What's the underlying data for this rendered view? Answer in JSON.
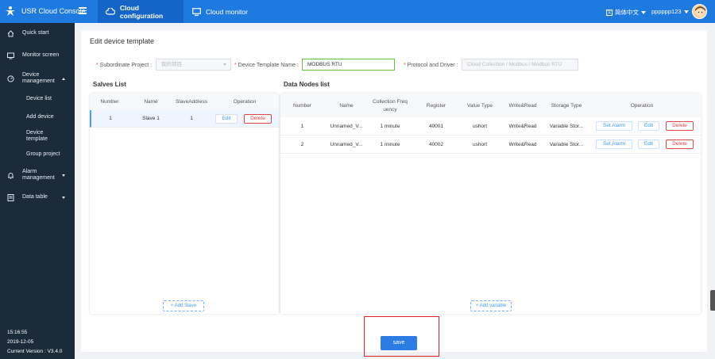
{
  "topbar": {
    "brand": "USR Cloud Console",
    "tabs": [
      {
        "label": "Cloud configuration",
        "active": true
      },
      {
        "label": "Cloud monitor",
        "active": false
      }
    ],
    "language": "简体中文",
    "username": "pppppp123",
    "colors": {
      "bar": "#1f7ae0",
      "active_tab": "#1565c8"
    }
  },
  "sidebar": {
    "items": [
      {
        "label": "Quick start",
        "icon": "home-icon"
      },
      {
        "label": "Monitor screen",
        "icon": "monitor-icon"
      },
      {
        "label": "Device management",
        "icon": "gauge-icon",
        "expanded": true
      },
      {
        "label": "Alarm management",
        "icon": "bell-icon"
      },
      {
        "label": "Data table",
        "icon": "table-icon"
      }
    ],
    "sub_items": [
      "Device list",
      "Add device",
      "Device template",
      "Group project"
    ],
    "footer": {
      "time": "15:16:55",
      "date": "2019-12-05",
      "version": "Current Version : V3.4.0"
    }
  },
  "page": {
    "title": "Edit device template",
    "form": {
      "project_label": "Subordinate Project :",
      "project_value": "我的项目",
      "template_label": "Device Template Name :",
      "template_value": "MODBUS RTU",
      "protocol_label": "Protocol and Driver :",
      "protocol_value": "Cloud Collection  /  Modbus  /  Modbus RTU"
    }
  },
  "slaves": {
    "title": "Salves List",
    "columns": [
      "Number",
      "Name",
      "SlaveAddress",
      "Operation"
    ],
    "rows": [
      {
        "number": "1",
        "name": "Slave 1",
        "address": "1",
        "edit": "Edit",
        "delete": "Delete"
      }
    ],
    "add_label": "+ Add Slave"
  },
  "nodes": {
    "title": "Data Nodes list",
    "columns": [
      "Number",
      "Name",
      "Collection Freq uency",
      "Register",
      "Value Type",
      "Write&Read",
      "Storage Type",
      "Operation"
    ],
    "rows": [
      {
        "number": "1",
        "name": "Unnamed_V...",
        "freq": "1 minute",
        "register": "40001",
        "type": "ushort",
        "rw": "Write&Read",
        "storage": "Variable Stor...",
        "alarm": "Set Alarm",
        "edit": "Edit",
        "delete": "Delete"
      },
      {
        "number": "2",
        "name": "Unnamed_V...",
        "freq": "1 minute",
        "register": "40002",
        "type": "ushort",
        "rw": "Write&Read",
        "storage": "Variable Stor...",
        "alarm": "Set Alarm",
        "edit": "Edit",
        "delete": "Delete"
      }
    ],
    "add_label": "+ Add variable"
  },
  "save_label": "save"
}
